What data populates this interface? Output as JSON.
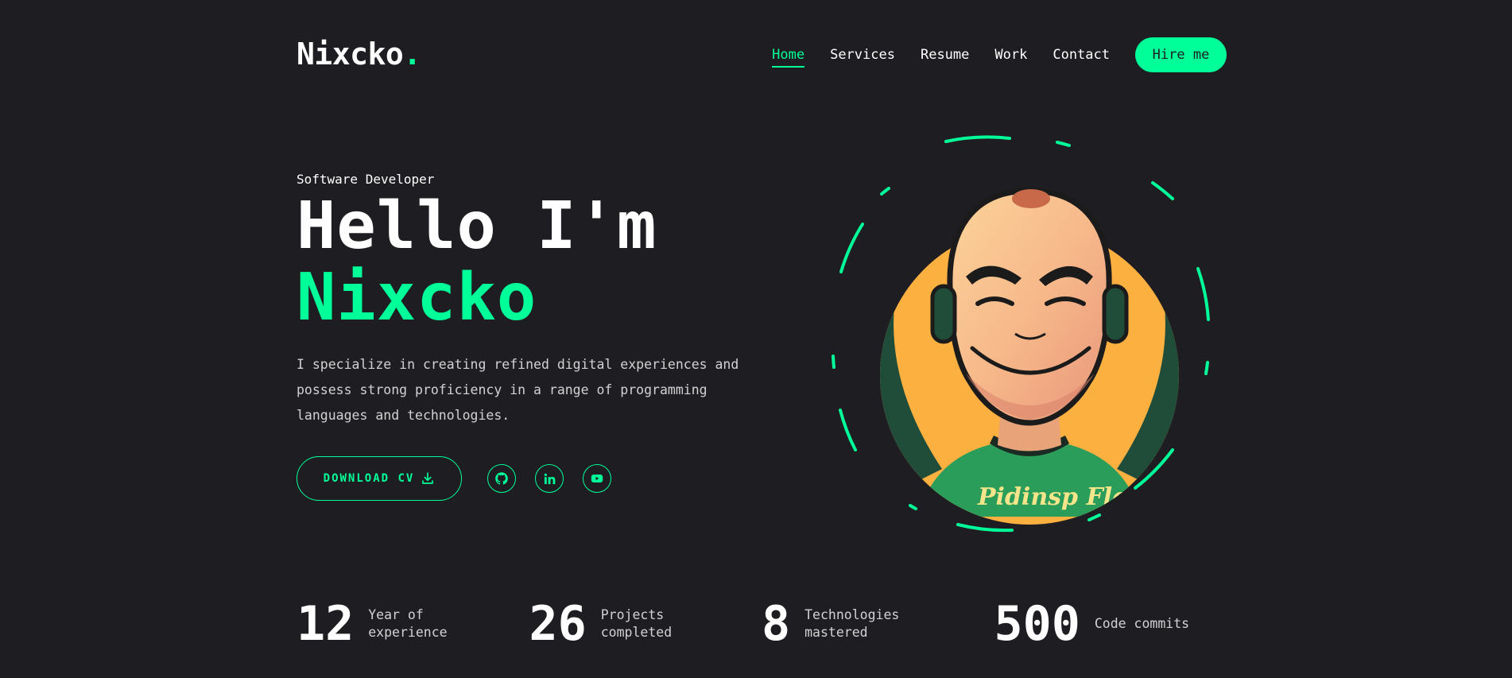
{
  "logo": {
    "text": "Nixcko",
    "dot": "."
  },
  "nav": {
    "items": [
      {
        "label": "Home",
        "active": true
      },
      {
        "label": "Services"
      },
      {
        "label": "Resume"
      },
      {
        "label": "Work"
      },
      {
        "label": "Contact"
      }
    ],
    "hire_label": "Hire me"
  },
  "hero": {
    "role": "Software Developer",
    "greeting": "Hello I'm",
    "name": "Nixcko",
    "description": "I specialize in creating refined digital experiences and possess strong proficiency in a range of programming languages and technologies.",
    "cv_label": "DOWNLOAD CV",
    "cv_icon": "download-icon",
    "socials": [
      {
        "icon": "github-icon"
      },
      {
        "icon": "linkedin-icon"
      },
      {
        "icon": "youtube-icon"
      }
    ]
  },
  "avatar": {
    "shirt_text": "Pidinsp Flow"
  },
  "stats": [
    {
      "number": "12",
      "label": "Year of experience"
    },
    {
      "number": "26",
      "label": "Projects completed"
    },
    {
      "number": "8",
      "label": "Technologies mastered"
    },
    {
      "number": "500",
      "label": "Code commits"
    }
  ],
  "colors": {
    "accent": "#00ff99",
    "background": "#1d1d22",
    "text": "#ffffff"
  }
}
